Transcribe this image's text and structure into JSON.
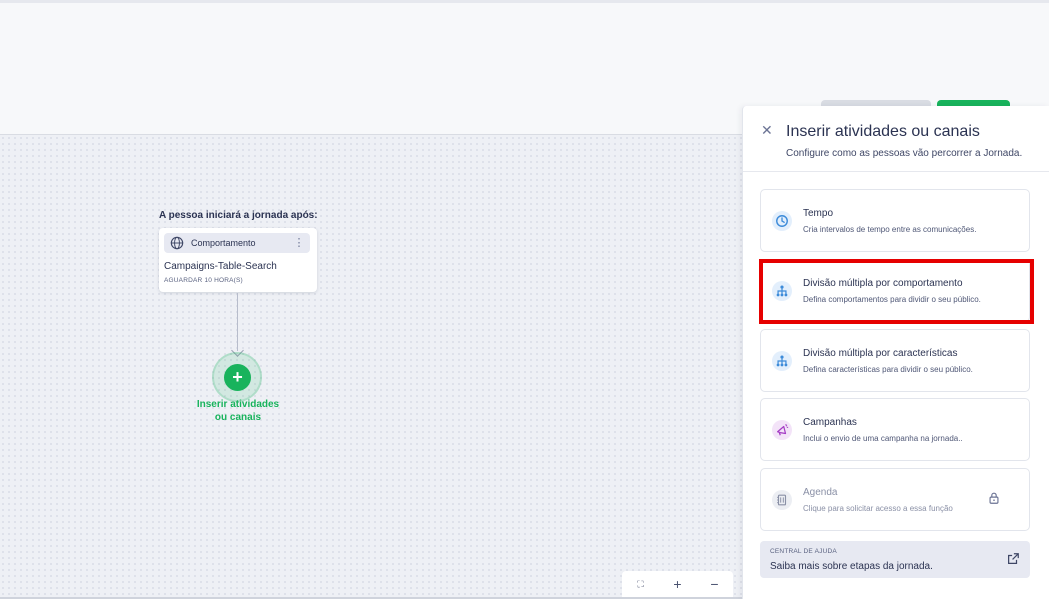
{
  "journey": {
    "start_title": "A pessoa iniciará a jornada após:",
    "node": {
      "type_label": "Comportamento",
      "name": "Campaigns-Table-Search",
      "wait": "AGUARDAR 10 HORA(S)"
    },
    "insert_label_line1": "Inserir atividades",
    "insert_label_line2": "ou canais"
  },
  "zoom": {
    "fit": "⛶",
    "in": "+",
    "out": "−"
  },
  "panel": {
    "title": "Inserir atividades ou canais",
    "subtitle": "Configure como as pessoas vão percorrer a Jornada.",
    "options": [
      {
        "title": "Tempo",
        "desc": "Cria intervalos de tempo entre as comunicações.",
        "icon": "clock-icon",
        "color": "#3d8bd9"
      },
      {
        "title": "Divisão múltipla por comportamento",
        "desc": "Defina comportamentos para dividir o seu público.",
        "icon": "split-icon",
        "color": "#3d8bd9"
      },
      {
        "title": "Divisão múltipla por características",
        "desc": "Defina características para dividir o seu público.",
        "icon": "split-icon",
        "color": "#3d8bd9"
      },
      {
        "title": "Campanhas",
        "desc": "Inclui o envio de uma campanha na jornada..",
        "icon": "megaphone-icon",
        "color": "#a43bc4"
      },
      {
        "title": "Agenda",
        "desc": "Clique para solicitar acesso a essa função",
        "icon": "calendar-icon",
        "color": "#8a90a6",
        "locked": true
      }
    ],
    "help": {
      "tag": "CENTRAL DE AJUDA",
      "link": "Saiba mais sobre etapas da jornada."
    }
  },
  "colors": {
    "accent": "#18b35c",
    "highlight": "#e60000"
  }
}
